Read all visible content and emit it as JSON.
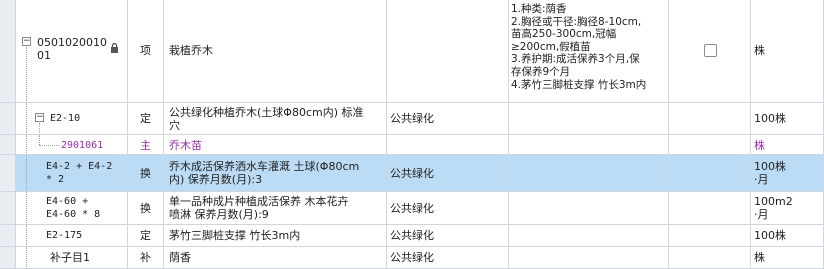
{
  "rows": [
    {
      "code": "0501020010\n01",
      "type": "项",
      "name": "栽植乔木",
      "spec": "",
      "features": "1.种类:荫香\n2.胸径或干径:胸径8-10cm,\n苗高250-300cm,冠幅\n≥200cm,假植苗\n3.养护期:成活保养3个月,保\n存保养9个月\n4.茅竹三脚桩支撑 竹长3m内",
      "unit": "株"
    },
    {
      "code": "E2-10",
      "type": "定",
      "name": "公共绿化种植乔木(土球Φ80cm内) 标准\n穴",
      "spec": "公共绿化",
      "unit": "100株"
    },
    {
      "code": "2901061",
      "type": "主",
      "name": "乔木苗",
      "spec": "",
      "unit": "株"
    },
    {
      "code": "E4-2 + E4-2\n* 2",
      "type": "换",
      "name": "乔木成活保养洒水车灌溉 土球(Φ80cm\n内)  保养月数(月):3",
      "spec": "公共绿化",
      "unit": "100株\n·月"
    },
    {
      "code": "E4-60 +\nE4-60 * 8",
      "type": "换",
      "name": "单一品种成片种植成活保养  木本花卉\n喷淋  保养月数(月):9",
      "spec": "公共绿化",
      "unit": "100m2\n·月"
    },
    {
      "code": "E2-175",
      "type": "定",
      "name": "茅竹三脚桩支撑 竹长3m内",
      "spec": "公共绿化",
      "unit": "100株"
    },
    {
      "code": "补子目1",
      "type": "补",
      "name": "荫香",
      "spec": "公共绿化",
      "unit": "株"
    }
  ],
  "colors": {
    "selected_row": "#bcdcf6",
    "main_material_text": "#9b2fae",
    "grid_line": "#cfd6df"
  },
  "icons": {
    "lock": "lock-icon",
    "collapse": "minus-box-icon",
    "checkbox": "checkbox-icon"
  }
}
